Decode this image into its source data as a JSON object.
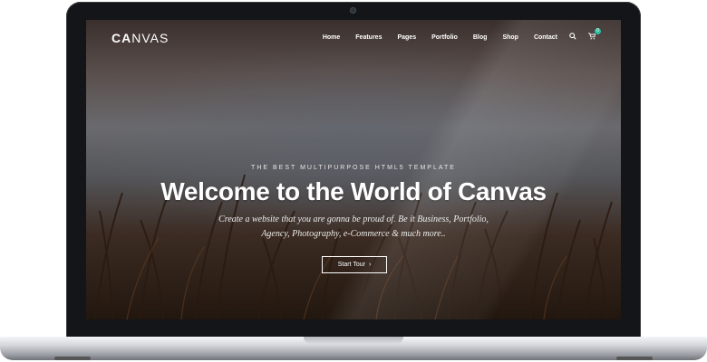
{
  "site": {
    "logo_bold": "CA",
    "logo_light": "NVAS"
  },
  "nav": {
    "items": [
      "Home",
      "Features",
      "Pages",
      "Portfolio",
      "Blog",
      "Shop",
      "Contact"
    ],
    "search_icon": "search-icon",
    "cart_icon": "cart-icon",
    "cart_count": "0"
  },
  "hero": {
    "kicker": "THE BEST MULTIPURPOSE HTML5 TEMPLATE",
    "headline": "Welcome to the World of Canvas",
    "subtitle_line1": "Create a website that you are gonna be proud of. Be it Business, Portfolio,",
    "subtitle_line2": "Agency, Photography, e-Commerce & much more..",
    "cta_label": "Start Tour",
    "cta_icon": "chevron-right-icon"
  },
  "colors": {
    "accent": "#1abc9c",
    "bezel": "#141518"
  }
}
